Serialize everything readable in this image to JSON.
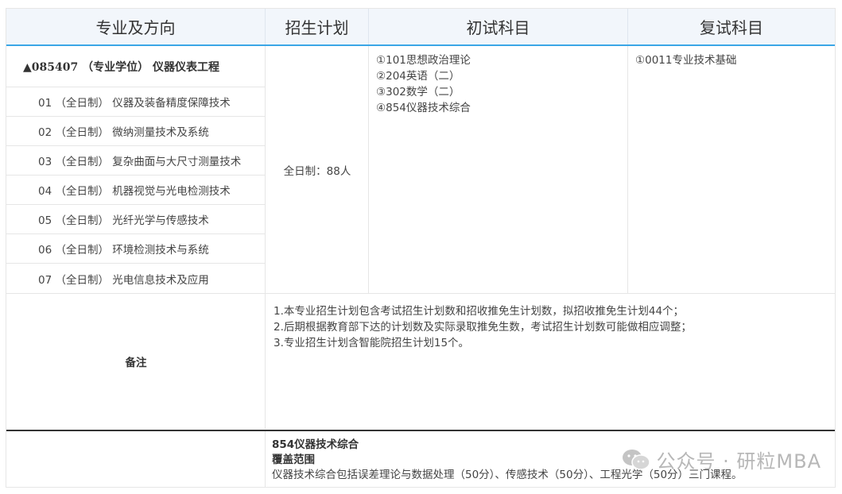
{
  "header": {
    "col1": "专业及方向",
    "col2": "招生计划",
    "col3": "初试科目",
    "col4": "复试科目"
  },
  "major": {
    "title": "▲085407 （专业学位） 仪器仪表工程"
  },
  "directions": [
    "01 （全日制） 仪器及装备精度保障技术",
    "02 （全日制） 微纳测量技术及系统",
    "03 （全日制） 复杂曲面与大尺寸测量技术",
    "04 （全日制） 机器视觉与光电检测技术",
    "05 （全日制） 光纤光学与传感技术",
    "06 （全日制） 环境检测技术与系统",
    "07 （全日制） 光电信息技术及应用"
  ],
  "plan": "全日制：88人",
  "initial_exam": [
    "①101思想政治理论",
    "②204英语（二）",
    "③302数学（二）",
    "④854仪器技术综合"
  ],
  "retest": [
    "①0011专业技术基础"
  ],
  "notes": {
    "label": "备注",
    "lines": [
      "1.本专业招生计划包含考试招生计划数和招收推免生计划数，拟招收推免生计划44个；",
      "2.后期根据教育部下达的计划数及实际录取推免生数，考试招生计划数可能做相应调整；",
      "3.专业招生计划含智能院招生计划15个。"
    ]
  },
  "bottom": {
    "title": "854仪器技术综合",
    "subtitle": "覆盖范围",
    "text": "仪器技术综合包括误差理论与数据处理（50分）、传感技术（50分）、工程光学（50分）三门课程。"
  },
  "watermark": {
    "text": "公众号 · 研粒MBA",
    "icon": "wechat-icon"
  }
}
